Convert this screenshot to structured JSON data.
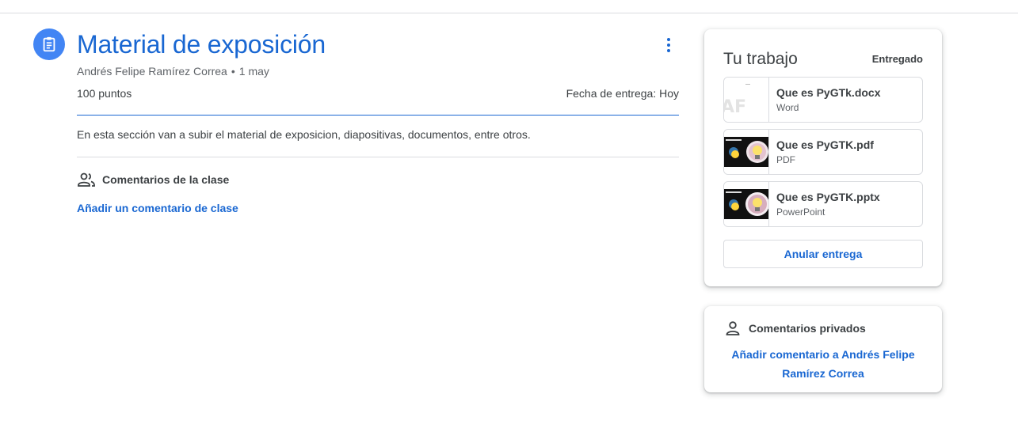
{
  "assignment": {
    "title": "Material de exposición",
    "author": "Andrés Felipe Ramírez Correa",
    "separator": "•",
    "date": "1 may",
    "points": "100 puntos",
    "due": "Fecha de entrega: Hoy",
    "description": "En esta sección van a subir el material de exposicion, diapositivas, documentos, entre otros."
  },
  "class_comments": {
    "label": "Comentarios de la clase",
    "add_link": "Añadir un comentario de clase"
  },
  "work": {
    "title": "Tu trabajo",
    "status": "Entregado",
    "attachments": [
      {
        "name": "Que es PyGTk.docx",
        "type": "Word",
        "icon": "word-doc-thumbnail"
      },
      {
        "name": "Que es PyGTK.pdf",
        "type": "PDF",
        "icon": "slide-thumbnail"
      },
      {
        "name": "Que es PyGTK.pptx",
        "type": "PowerPoint",
        "icon": "slide-thumbnail"
      }
    ],
    "unsubmit_label": "Anular entrega"
  },
  "private_comments": {
    "label": "Comentarios privados",
    "add_link": "Añadir comentario a Andrés Felipe Ramírez Correa"
  },
  "colors": {
    "accent": "#1967d2",
    "icon_bg": "#4285f4",
    "text": "#3c4043",
    "muted": "#5f6368",
    "divider": "#dadce0"
  },
  "icons": [
    "assignment-icon",
    "more-vert-icon",
    "people-icon",
    "person-icon"
  ]
}
